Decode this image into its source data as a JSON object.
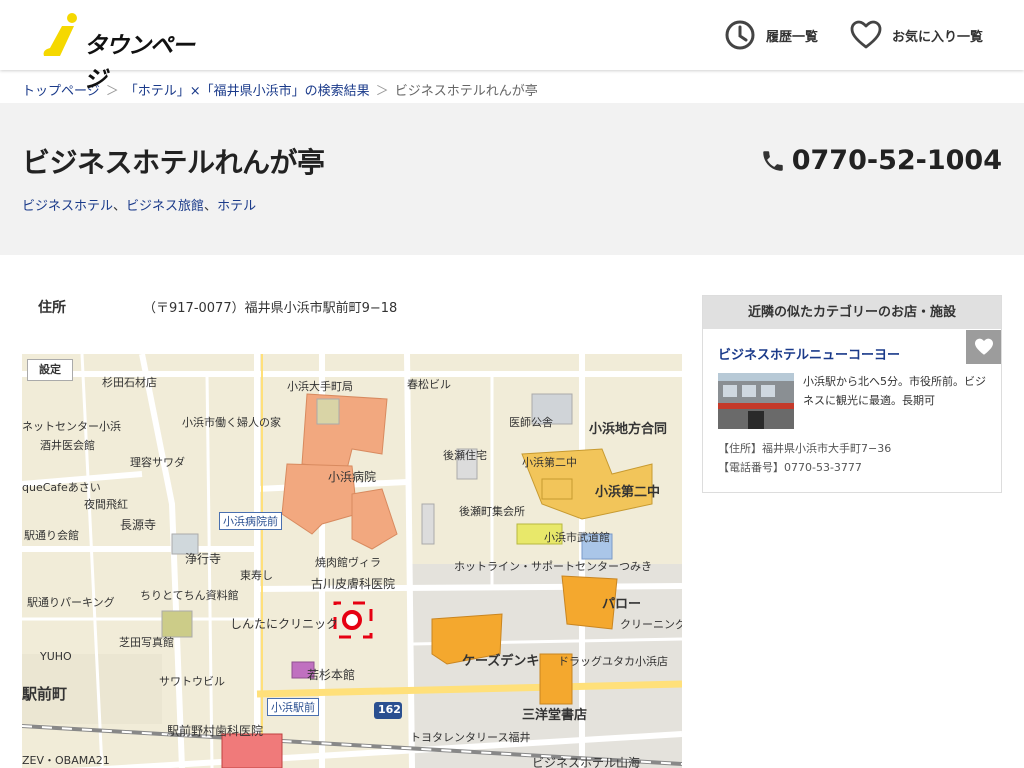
{
  "header": {
    "logo_text": "タウンページ",
    "nav_history": "履歴一覧",
    "nav_favorites": "お気に入り一覧"
  },
  "breadcrumb": {
    "home": "トップページ",
    "search": "「ホテル」×「福井県小浜市」の検索結果",
    "current": "ビジネスホテルれんが亭"
  },
  "business": {
    "name": "ビジネスホテルれんが亭",
    "categories": [
      "ビジネスホテル",
      "ビジネス旅館",
      "ホテル"
    ],
    "phone": "0770-52-1004",
    "address_label": "住所",
    "address": "（〒917-0077）福井県小浜市駅前町9−18"
  },
  "map": {
    "setting_label": "設定",
    "labels": {
      "a1": "杉田石材店",
      "a2": "小浜大手町局",
      "a3": "春松ビル",
      "a4": "小浜市働く婦人の家",
      "a5": "医師公舎",
      "a6": "小浜地方合同",
      "a7": "ネットセンター小浜",
      "a8": "酒井医会館",
      "a9": "理容サワダ",
      "a10": "後瀬住宅",
      "a11": "小浜第二中",
      "a12": "小浜病院",
      "a13": "小浜第二中",
      "a14": "queCafeあさい",
      "a15": "夜間飛紅",
      "a16": "長源寺",
      "a17": "小浜病院前",
      "a18": "後瀬町集会所",
      "a19": "駅通り会館",
      "a20": "小浜市武道館",
      "a21": "浄行寺",
      "a22": "焼肉館ヴィラ",
      "a23": "ホットライン・サポートセンターつみき",
      "a24": "東寿し",
      "a25": "古川皮膚科医院",
      "a26": "ちりとてちん資料館",
      "a27": "パロー",
      "a28": "駅通りパーキング",
      "a29": "しんたにクリニック",
      "a30": "クリーニング",
      "a31": "芝田写真館",
      "a32": "ケーズデンキ",
      "a33": "YUHO",
      "a34": "ドラッグユタカ小浜店",
      "a35": "若杉本館",
      "a36": "サワトウビル",
      "a37": "駅前町",
      "a38": "三洋堂書店",
      "a39": "小浜駅前",
      "a40": "駅前野村歯科医院",
      "a41": "トヨタレンタリース福井",
      "a42": "ZEV・OBAMA21",
      "a43": "ビジネスホテル山海",
      "r162": "162"
    }
  },
  "nearby": {
    "heading": "近隣の似たカテゴリーのお店・施設",
    "name": "ビジネスホテルニューコーヨー",
    "description": "小浜駅から北へ5分。市役所前。ビジネスに観光に最適。長期可",
    "address": "【住所】福井県小浜市大手町7−36",
    "phone": "【電話番号】0770-53-3777"
  },
  "colors": {
    "link": "#1a3a8a",
    "logo_yellow": "#f5d800",
    "title_bg": "#f2f2f2",
    "map_bg": "#f1ecd8",
    "marker": "#e60012"
  }
}
